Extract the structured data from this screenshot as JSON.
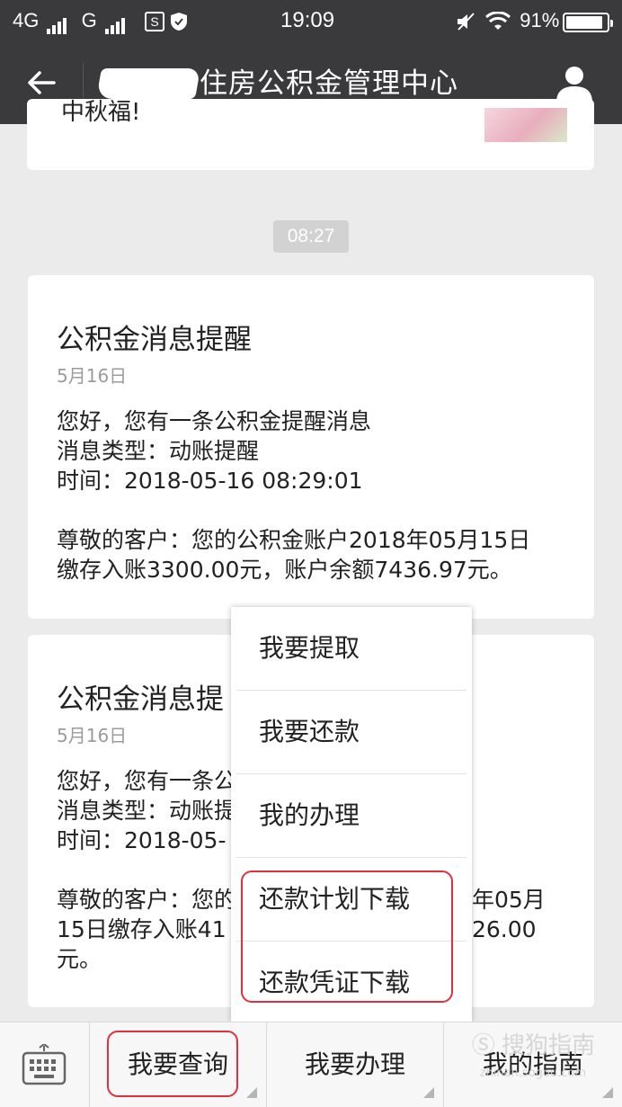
{
  "status_bar": {
    "network": "4G",
    "network2": "G",
    "time": "19:09",
    "battery": "91%",
    "battery_level": 0.91
  },
  "header": {
    "title": "住房公积金管理中心"
  },
  "previous_card": {
    "text": "中秋福!"
  },
  "timestamp": "08:27",
  "messages": [
    {
      "title": "公积金消息提醒",
      "date": "5月16日",
      "lines": [
        "您好，您有一条公积金提醒消息",
        "消息类型：动账提醒",
        "时间：2018-05-16 08:29:01",
        "尊敬的客户：您的公积金账户2018年05月15日",
        "缴存入账3300.00元，账户余额7436.97元。"
      ]
    },
    {
      "title": "公积金消息提",
      "date": "5月16日",
      "lines": [
        "您好，您有一条公",
        "消息类型：动账提",
        "时间：2018-05-",
        "尊敬的客户：您的",
        "15日缴存入账41",
        "元。"
      ],
      "right_fragments": [
        "年05月",
        "26.00"
      ]
    }
  ],
  "popup_menu": {
    "items": [
      "我要提取",
      "我要还款",
      "我的办理",
      "还款计划下载",
      "还款凭证下载"
    ]
  },
  "bottom_bar": {
    "tabs": [
      "我要查询",
      "我要办理",
      "我的指南"
    ]
  },
  "watermark": {
    "text": "搜狗指南",
    "sub": "zhinan.sogou.com"
  },
  "colors": {
    "header_bg": "#3a3a3c",
    "chat_bg": "#ebebeb",
    "highlight": "#e0303b"
  }
}
